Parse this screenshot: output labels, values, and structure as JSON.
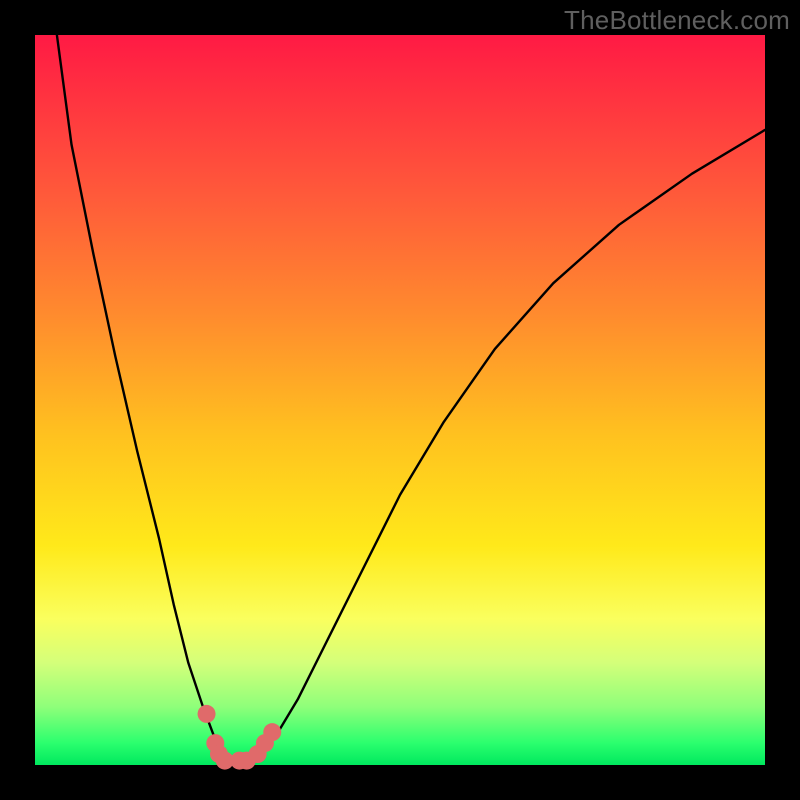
{
  "attribution": "TheBottleneck.com",
  "chart_data": {
    "type": "line",
    "title": "",
    "xlabel": "",
    "ylabel": "",
    "xlim": [
      0,
      100
    ],
    "ylim": [
      0,
      100
    ],
    "series": [
      {
        "name": "bottleneck-curve",
        "x": [
          3,
          5,
          8,
          11,
          14,
          17,
          19,
          21,
          23,
          24.5,
          26,
          27.5,
          29,
          31,
          33,
          36,
          40,
          45,
          50,
          56,
          63,
          71,
          80,
          90,
          100
        ],
        "y": [
          100,
          85,
          70,
          56,
          43,
          31,
          22,
          14,
          8,
          4,
          1.5,
          0.6,
          0.6,
          1.8,
          4,
          9,
          17,
          27,
          37,
          47,
          57,
          66,
          74,
          81,
          87
        ]
      }
    ],
    "markers": [
      {
        "name": "point-1",
        "x": 23.5,
        "y": 7.0
      },
      {
        "name": "point-2",
        "x": 24.7,
        "y": 3.0
      },
      {
        "name": "point-3",
        "x": 25.2,
        "y": 1.5
      },
      {
        "name": "point-4",
        "x": 26.0,
        "y": 0.6
      },
      {
        "name": "point-5",
        "x": 28.0,
        "y": 0.6
      },
      {
        "name": "point-6",
        "x": 29.0,
        "y": 0.6
      },
      {
        "name": "point-7",
        "x": 30.5,
        "y": 1.5
      },
      {
        "name": "point-8",
        "x": 31.5,
        "y": 3.0
      },
      {
        "name": "point-9",
        "x": 32.5,
        "y": 4.5
      }
    ],
    "marker_color": "#e06a6a",
    "curve_color": "#000000"
  }
}
